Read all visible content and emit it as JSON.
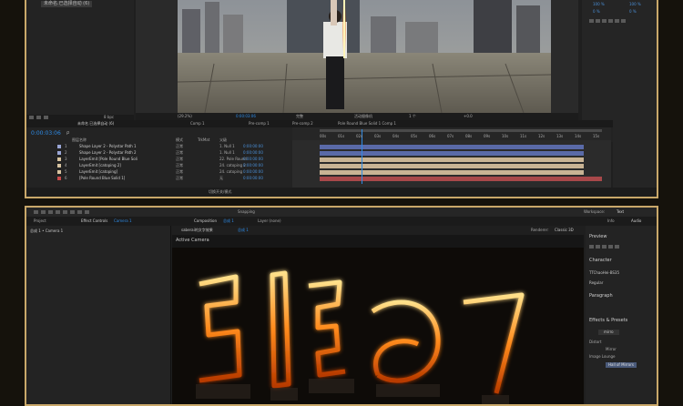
{
  "top": {
    "project_file": "未命名.已选择自动 (6)",
    "bit_label": "8 bpc",
    "viewer": {
      "zoom": "(29.2%)",
      "timecode": "0:00:03:06",
      "quality": "完整",
      "camera": "活动摄像机",
      "views": "1 个",
      "offset": "+0.0"
    },
    "right_panel": {
      "values": [
        "100 %",
        "100 %",
        "0 %",
        "0 %"
      ]
    },
    "tabs": [
      "未命名 已选择自动 (6)",
      "Comp 1",
      "Pre-comp 1",
      "Pre-comp 2",
      "Pole Round Blue Solid 1 Comp 1"
    ],
    "timecode": "0:00:03:06",
    "search_placeholder": "ρ",
    "columns": {
      "name": "图层名称",
      "mode": "模式",
      "trkmat": "TrkMat",
      "parent": "父级"
    },
    "layers": [
      {
        "num": "1",
        "name": "Shape Layer 2 - Polystar Path 1",
        "mode": "正常",
        "parent": "1. Null 1",
        "color": "#9aa6d6",
        "track": "blue"
      },
      {
        "num": "2",
        "name": "Shape Layer 2 - Polystar Path 2",
        "mode": "正常",
        "parent": "1. Null 1",
        "color": "#9aa6d6",
        "track": "blue"
      },
      {
        "num": "3",
        "name": "LayerEmit [Pole Round Blue Soli",
        "mode": "正常",
        "parent": "22. Pole Round",
        "color": "#d8c4a0",
        "track": "tan"
      },
      {
        "num": "4",
        "name": "LayerEmit [catoping 2]",
        "mode": "正常",
        "parent": "24. catoping 2",
        "color": "#d8c4a0",
        "track": "tan"
      },
      {
        "num": "5",
        "name": "LayerEmit [catoping]",
        "mode": "正常",
        "parent": "24. catoping",
        "color": "#d8c4a0",
        "track": "tan"
      },
      {
        "num": "6",
        "name": "[Pole Round Blue Solid 1]",
        "mode": "正常",
        "parent": "无",
        "color": "#c84a4a",
        "track": "red"
      }
    ],
    "ruler_ticks": [
      "00s",
      "01s",
      "02s",
      "03s",
      "04s",
      "05s",
      "06s",
      "07s",
      "08s",
      "09s",
      "10s",
      "11s",
      "12s",
      "13s",
      "14s",
      "15s"
    ],
    "layer_times": [
      "0:00:00:00",
      "0:00:00:00",
      "0:00:00:00",
      "0:00:00:00",
      "0:00:00:00",
      "0:00:00:00"
    ],
    "bottom_label": "切换开关/模式"
  },
  "bottom": {
    "project_tab": "Project",
    "effect_controls_tab": "Effect Controls",
    "effect_controls_camera": "Camera 1",
    "project_item": "总成 1 • Camera 1",
    "composition_tab": "Composition",
    "composition_name": "总成 1",
    "layer_tab": "Layer (none)",
    "snapping": "Snapping",
    "workspace_label": "Workspace:",
    "workspace_value": "Text",
    "comp_breadcrumb_1": "saberai的文字效果",
    "comp_breadcrumb_2": "总成 1",
    "renderer_label": "Renderer:",
    "renderer_value": "Classic 3D",
    "active_camera": "Active Camera",
    "side_tabs": [
      "Info",
      "Audio"
    ],
    "preview_label": "Preview",
    "character_label": "Character",
    "font_name": "TTChaoHei-BS35",
    "font_style": "Regular",
    "paragraph_label": "Paragraph",
    "effects_label": "Effects & Presets",
    "search_value": "mirro",
    "tree": {
      "distort": "Distort",
      "mirror": "Mirror",
      "image_lounge": "Image Lounge",
      "hall_of_mirrors": "Hall of Mirrors"
    }
  },
  "colors": {
    "frame_border": "#c9a86a",
    "panel_bg": "#1f1f1f",
    "accent_blue": "#2e8be6",
    "playhead": "#2e8be6",
    "fire": "#ff8a1c"
  }
}
